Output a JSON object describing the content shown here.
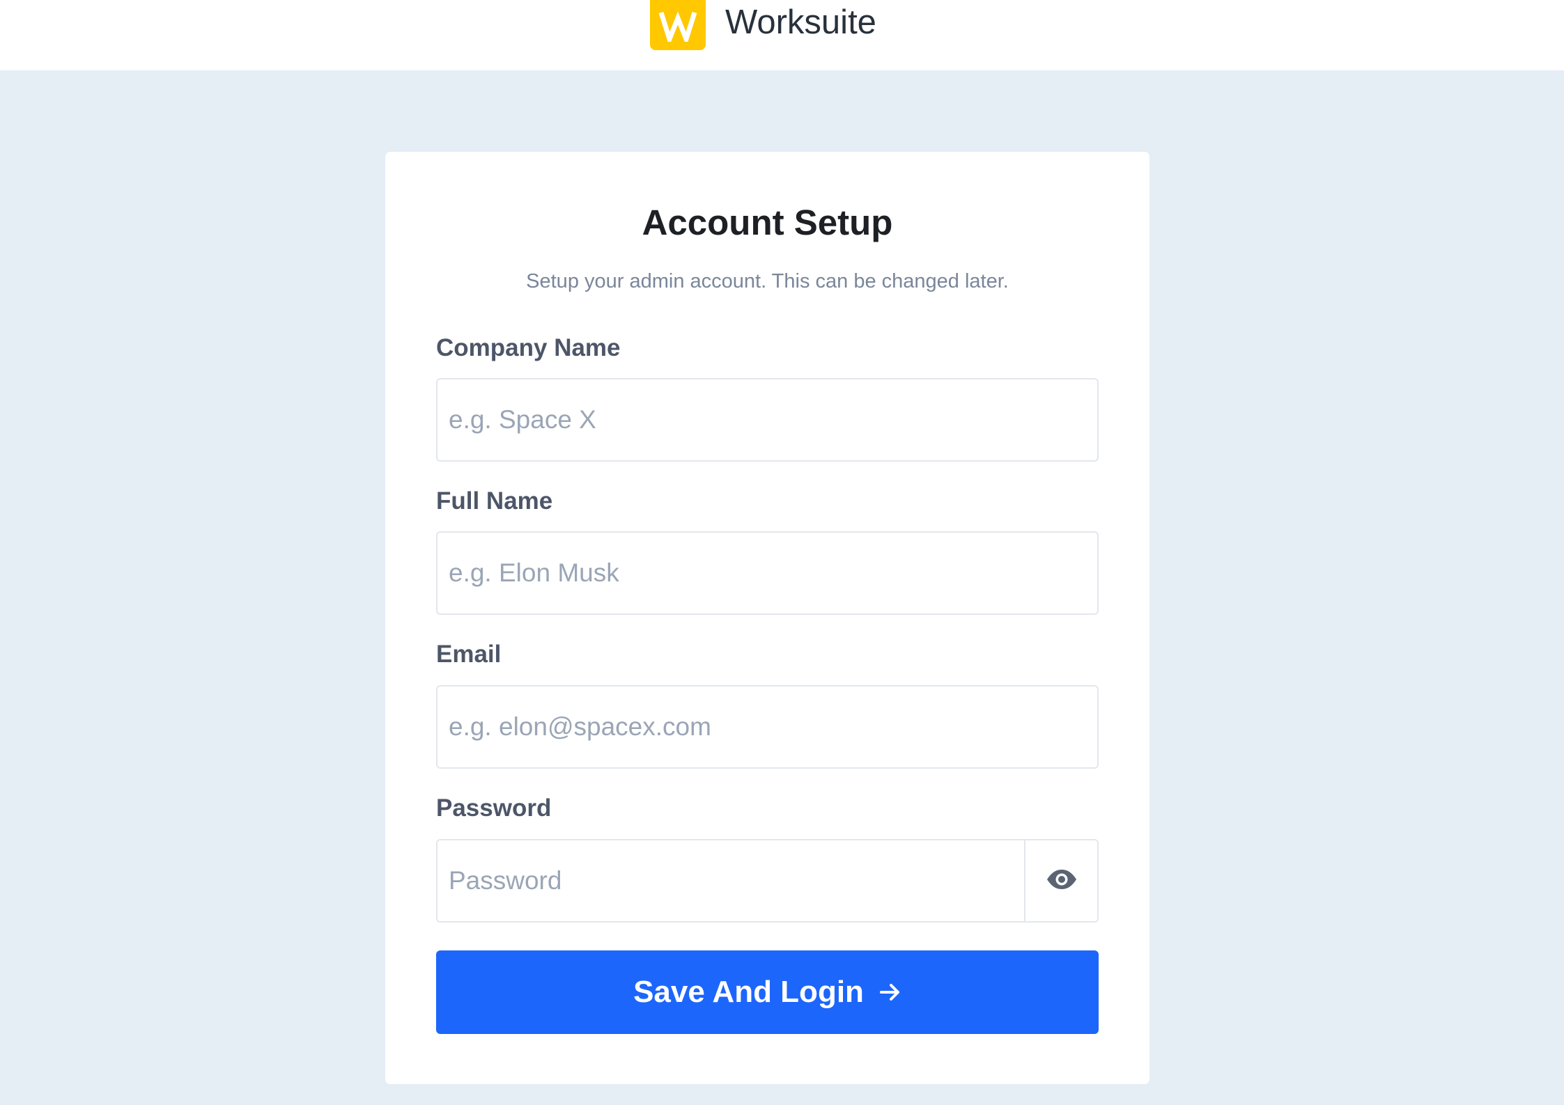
{
  "brand": {
    "name": "Worksuite",
    "logo_letter": "W",
    "logo_color": "#ffc800"
  },
  "card": {
    "title": "Account Setup",
    "subtitle": "Setup your admin account. This can be changed later."
  },
  "form": {
    "company": {
      "label": "Company Name",
      "placeholder": "e.g. Space X",
      "value": ""
    },
    "full_name": {
      "label": "Full Name",
      "placeholder": "e.g. Elon Musk",
      "value": ""
    },
    "email": {
      "label": "Email",
      "placeholder": "e.g. elon@spacex.com",
      "value": ""
    },
    "password": {
      "label": "Password",
      "placeholder": "Password",
      "value": "",
      "toggle_icon": "eye-icon"
    },
    "submit_label": "Save And Login",
    "submit_icon": "arrow-right-icon",
    "accent_color": "#1d66fb"
  },
  "colors": {
    "page_background": "#e5edf5",
    "card_background": "#ffffff"
  }
}
